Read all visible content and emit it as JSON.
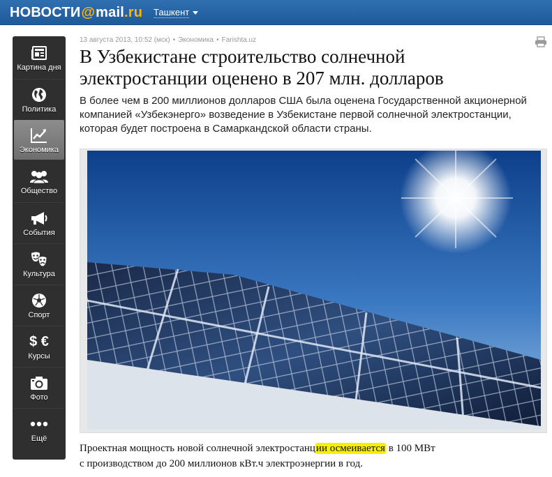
{
  "header": {
    "logo_part1": "НОВОСТИ",
    "logo_at": "@",
    "logo_part2": "mail",
    "logo_part3": ".ru",
    "region": "Ташкент",
    "colors": {
      "bar": "#2468a8",
      "accent": "#ffb400"
    }
  },
  "sidebar": {
    "items": [
      {
        "label": "Картина дня",
        "icon": "newspaper-icon"
      },
      {
        "label": "Политика",
        "icon": "globe-icon"
      },
      {
        "label": "Экономика",
        "icon": "chart-icon",
        "active": true
      },
      {
        "label": "Общество",
        "icon": "people-icon"
      },
      {
        "label": "События",
        "icon": "megaphone-icon"
      },
      {
        "label": "Культура",
        "icon": "theater-masks-icon"
      },
      {
        "label": "Спорт",
        "icon": "soccer-ball-icon"
      },
      {
        "label": "Курсы",
        "icon": "currency-icon",
        "glyph": "$ €"
      },
      {
        "label": "Фото",
        "icon": "camera-icon"
      },
      {
        "label": "Ещё",
        "icon": "more-dots-icon"
      }
    ]
  },
  "article": {
    "date": "13 августа 2013, 10:52 (мск)",
    "rubric": "Экономика",
    "source": "Farishta.uz",
    "title": "В Узбекистане строительство солнечной электростанции оценено в 207 млн. долларов",
    "lead": "В более чем в 200 миллионов долларов США была оценена Государственной акционерной компанией «Узбекэнерго» возведение в Узбекистане первой солнечной электростанции, которая будет построена в Самаркандской области страны.",
    "body_before": "Проектная мощность новой солнечной электростанц",
    "body_highlight": "ии осмеивается",
    "body_after": " в 100 МВт",
    "body_line2": "с производством до 200 миллионов кВт.ч электроэнергии в год."
  }
}
